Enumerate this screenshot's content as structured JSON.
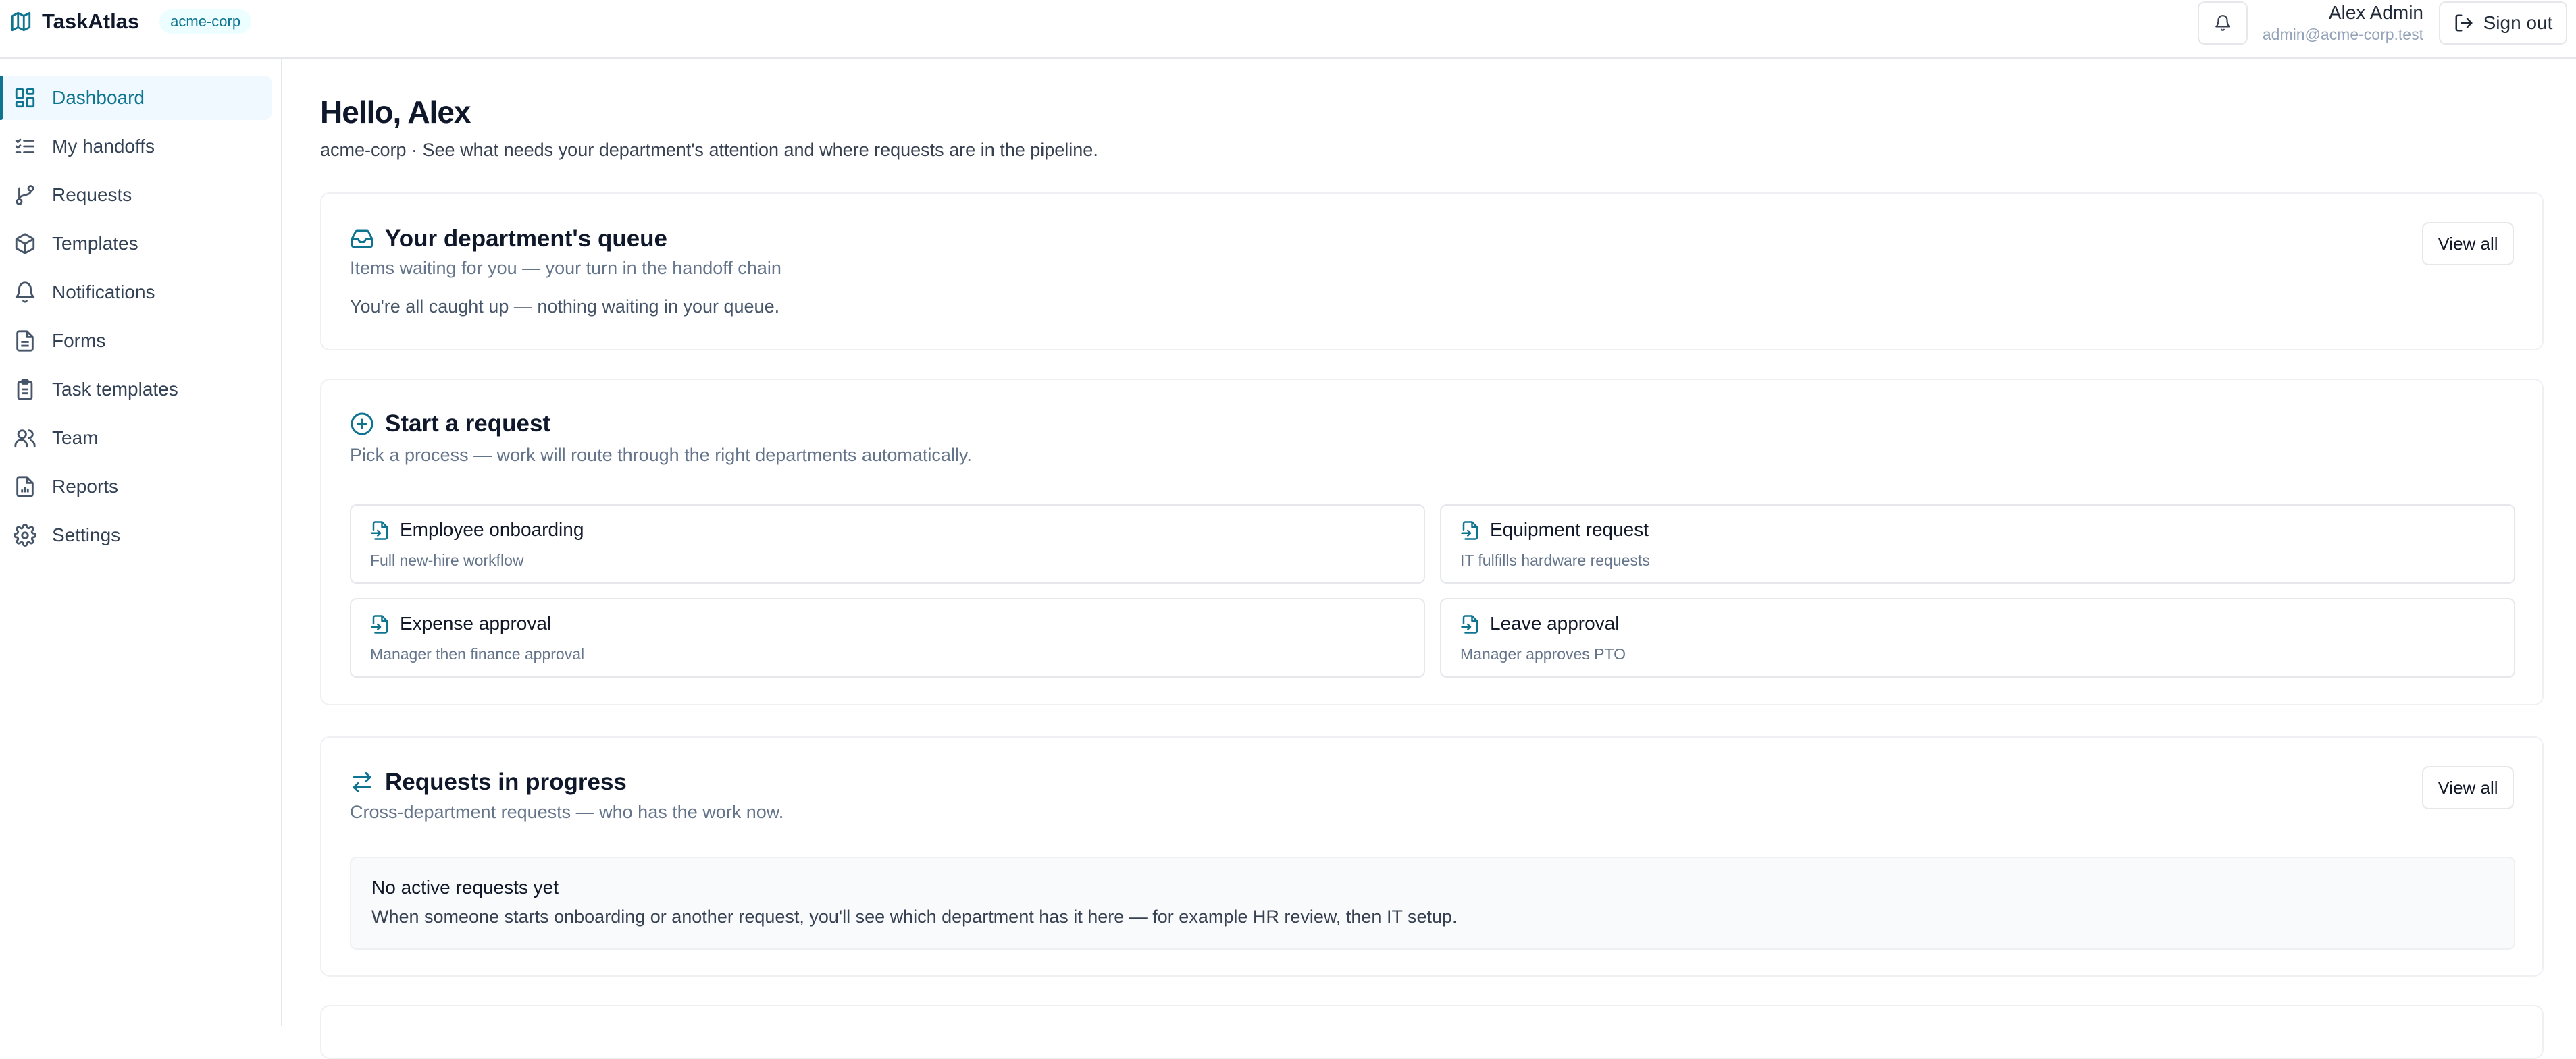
{
  "app": {
    "name": "TaskAtlas",
    "org_badge": "acme-corp",
    "logo_icon": "map-icon"
  },
  "header": {
    "user_name": "Alex Admin",
    "user_email": "admin@acme-corp.test",
    "signout_label": "Sign out"
  },
  "sidebar": {
    "items": [
      {
        "label": "Dashboard",
        "icon": "dashboard-icon",
        "active": true
      },
      {
        "label": "My handoffs",
        "icon": "list-checks-icon"
      },
      {
        "label": "Requests",
        "icon": "git-branch-icon"
      },
      {
        "label": "Templates",
        "icon": "box-icon"
      },
      {
        "label": "Notifications",
        "icon": "bell-icon"
      },
      {
        "label": "Forms",
        "icon": "document-icon"
      },
      {
        "label": "Task templates",
        "icon": "clipboard-icon"
      },
      {
        "label": "Team",
        "icon": "users-icon"
      },
      {
        "label": "Reports",
        "icon": "report-icon"
      },
      {
        "label": "Settings",
        "icon": "gear-icon"
      }
    ]
  },
  "main": {
    "greeting": "Hello, Alex",
    "subtitle": "acme-corp · See what needs your department's attention and where requests are in the pipeline.",
    "queue": {
      "title": "Your department's queue",
      "description": "Items waiting for you — your turn in the handoff chain",
      "empty_text": "You're all caught up — nothing waiting in your queue.",
      "view_all": "View all"
    },
    "start": {
      "title": "Start a request",
      "description": "Pick a process — work will route through the right departments automatically.",
      "processes": [
        {
          "name": "Employee onboarding",
          "description": "Full new-hire workflow"
        },
        {
          "name": "Equipment request",
          "description": "IT fulfills hardware requests"
        },
        {
          "name": "Expense approval",
          "description": "Manager then finance approval"
        },
        {
          "name": "Leave approval",
          "description": "Manager approves PTO"
        }
      ]
    },
    "progress": {
      "title": "Requests in progress",
      "description": "Cross-department requests — who has the work now.",
      "view_all": "View all",
      "empty_title": "No active requests yet",
      "empty_text": "When someone starts onboarding or another request, you'll see which department has it here — for example HR review, then IT setup."
    }
  },
  "colors": {
    "accent": "#0e7490",
    "active_bg": "#f0f9ff",
    "border": "#e5e7eb",
    "muted_text": "#64748b"
  }
}
